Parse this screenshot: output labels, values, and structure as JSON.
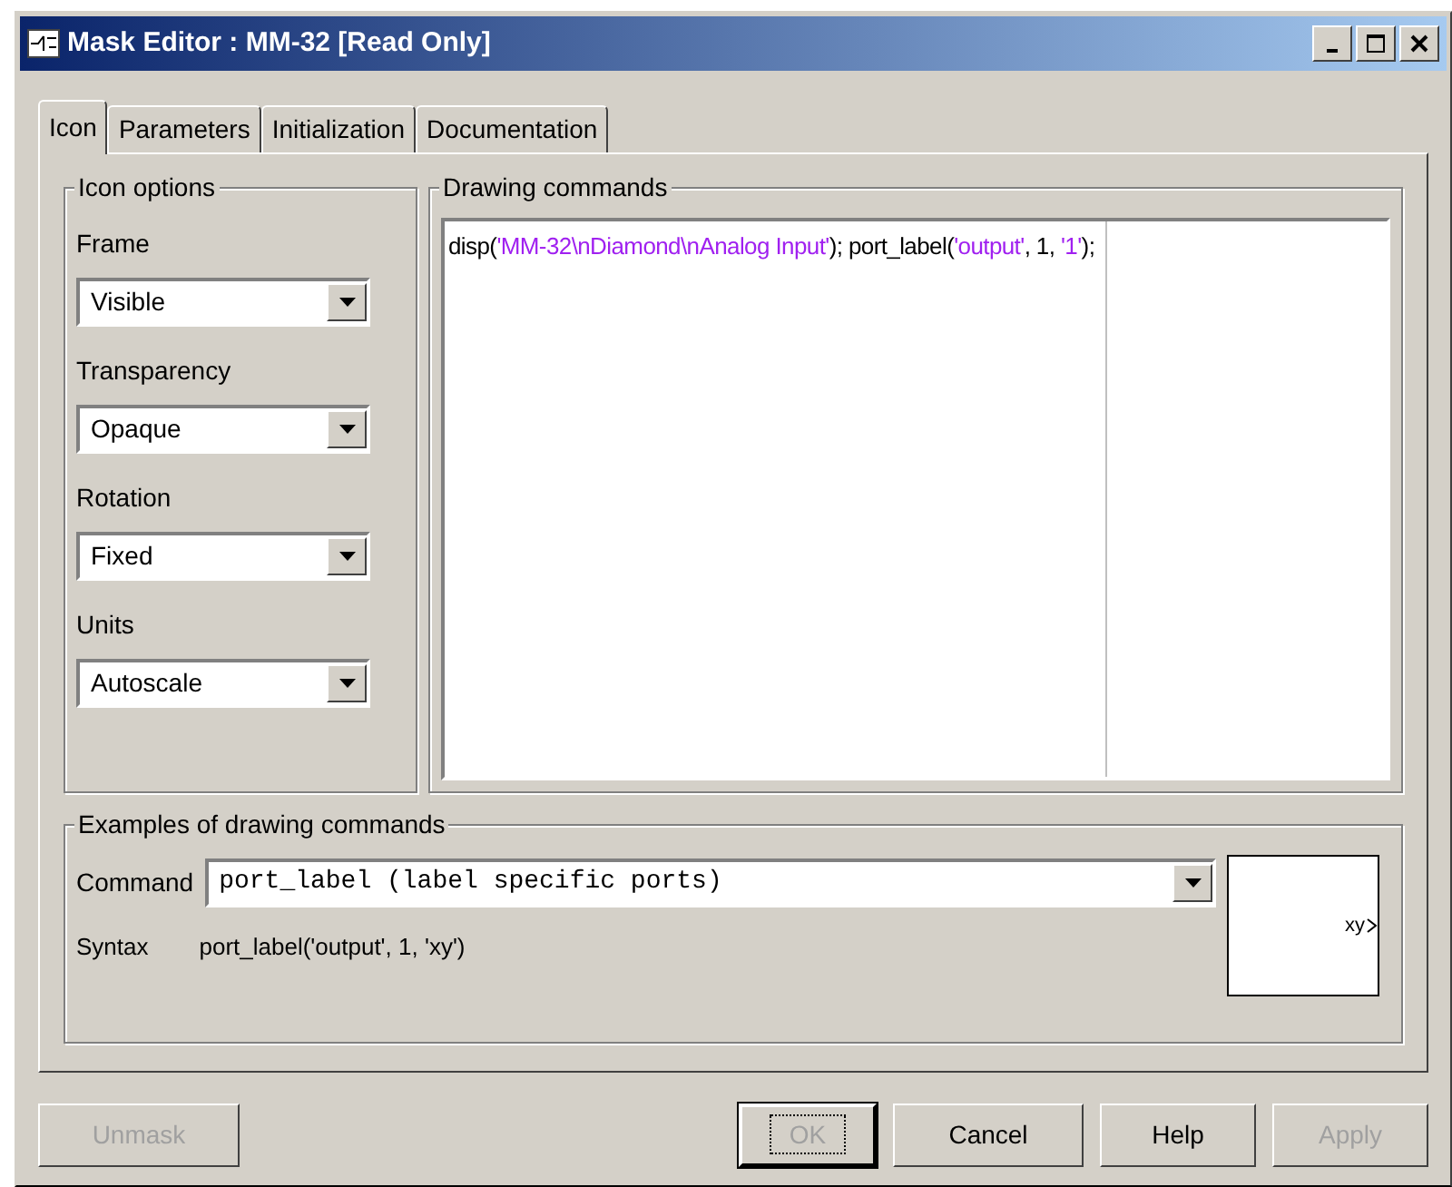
{
  "window": {
    "title": "Mask Editor : MM-32  [Read Only]"
  },
  "tabs": [
    {
      "label": "Icon",
      "selected": true
    },
    {
      "label": "Parameters",
      "selected": false
    },
    {
      "label": "Initialization",
      "selected": false
    },
    {
      "label": "Documentation",
      "selected": false
    }
  ],
  "icon_options": {
    "title": "Icon options",
    "fields": [
      {
        "label": "Frame",
        "value": "Visible"
      },
      {
        "label": "Transparency",
        "value": "Opaque"
      },
      {
        "label": "Rotation",
        "value": "Fixed"
      },
      {
        "label": "Units",
        "value": "Autoscale"
      }
    ]
  },
  "drawing_commands": {
    "title": "Drawing commands",
    "code": [
      {
        "kind": "plain",
        "text": "disp("
      },
      {
        "kind": "string",
        "text": "'MM-32\\nDiamond\\nAnalog Input'"
      },
      {
        "kind": "plain",
        "text": "); port_label("
      },
      {
        "kind": "string",
        "text": "'output'"
      },
      {
        "kind": "plain",
        "text": ", 1, "
      },
      {
        "kind": "string",
        "text": "'1'"
      },
      {
        "kind": "plain",
        "text": ");"
      }
    ]
  },
  "examples": {
    "title": "Examples of drawing commands",
    "command_label": "Command",
    "command_value": "port_label (label specific ports)",
    "syntax_label": "Syntax",
    "syntax_value": "port_label('output', 1, 'xy')",
    "preview_label": "xy"
  },
  "buttons": [
    {
      "label": "Unmask",
      "disabled": true,
      "focused": false
    },
    {
      "label": "OK",
      "disabled": true,
      "focused": true
    },
    {
      "label": "Cancel",
      "disabled": false,
      "focused": false
    },
    {
      "label": "Help",
      "disabled": false,
      "focused": false
    },
    {
      "label": "Apply",
      "disabled": true,
      "focused": false
    }
  ]
}
